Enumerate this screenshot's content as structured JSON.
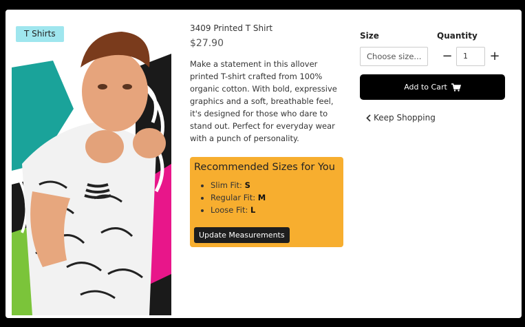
{
  "product": {
    "category": "T Shirts",
    "name": "3409 Printed T Shirt",
    "price": "$27.90",
    "description": "Make a statement in this allover printed T-shirt crafted from 100% organic cotton. With bold, expressive graphics and a soft, breathable feel, it's designed for those who dare to stand out. Perfect for everyday wear with a punch of personality."
  },
  "recommendations": {
    "title": "Recommended Sizes for You",
    "items": [
      {
        "label": "Slim Fit: ",
        "size": "S"
      },
      {
        "label": "Regular Fit: ",
        "size": "M"
      },
      {
        "label": "Loose Fit: ",
        "size": "L"
      }
    ],
    "update_button": "Update Measurements"
  },
  "purchase": {
    "size_label": "Size",
    "size_placeholder": "Choose size...",
    "quantity_label": "Quantity",
    "quantity_value": "1",
    "minus": "−",
    "plus": "+",
    "add_to_cart": "Add to Cart",
    "keep_shopping": "Keep Shopping"
  },
  "icons": {
    "cart": "cart-icon",
    "back": "chevron-left-icon"
  },
  "colors": {
    "category_tag": "#9fe6ee",
    "recommendation_box": "#f7ae2f",
    "cart_button": "#000000"
  }
}
